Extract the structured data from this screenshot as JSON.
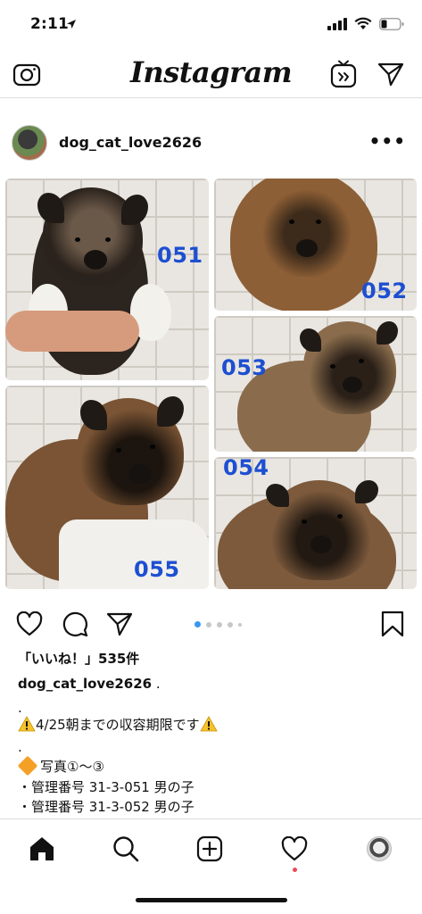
{
  "status_bar": {
    "time": "2:11",
    "icons": [
      "location-arrow-icon",
      "signal-icon",
      "wifi-icon",
      "battery-icon"
    ]
  },
  "header": {
    "logo_text": "Instagram",
    "icons": [
      "camera-icon",
      "igtv-icon",
      "direct-message-icon"
    ]
  },
  "post": {
    "username": "dog_cat_love2626",
    "more_label": "•••",
    "photos": [
      {
        "label": "051",
        "fur": "#2c241e"
      },
      {
        "label": "052",
        "fur": "#8d5f36"
      },
      {
        "label": "053",
        "fur": "#8a6c4c"
      },
      {
        "label": "054",
        "fur": "#7d5a3c"
      },
      {
        "label": "055",
        "fur": "#7a5434"
      }
    ],
    "carousel": {
      "count": 5,
      "active_index": 0
    },
    "likes": "「いいね！」535件",
    "caption": {
      "username": "dog_cat_love2626",
      "first_line_rest": " .",
      "lines": [
        ".",
        "4/25朝までの収容期限です",
        ".",
        "写真①～③",
        "・管理番号 31-3-051 男の子",
        "・管理番号 31-3-052 男の子"
      ]
    }
  },
  "colors": {
    "accent_blue": "#3897f0",
    "photo_label_blue": "#1d4fd1",
    "notification_red": "#ed4956",
    "warning_yellow": "#f7c22c",
    "diamond_orange": "#f4a027"
  },
  "tab_bar": {
    "tabs": [
      "home-icon",
      "search-icon",
      "new-post-icon",
      "activity-heart-icon",
      "profile-avatar"
    ]
  }
}
